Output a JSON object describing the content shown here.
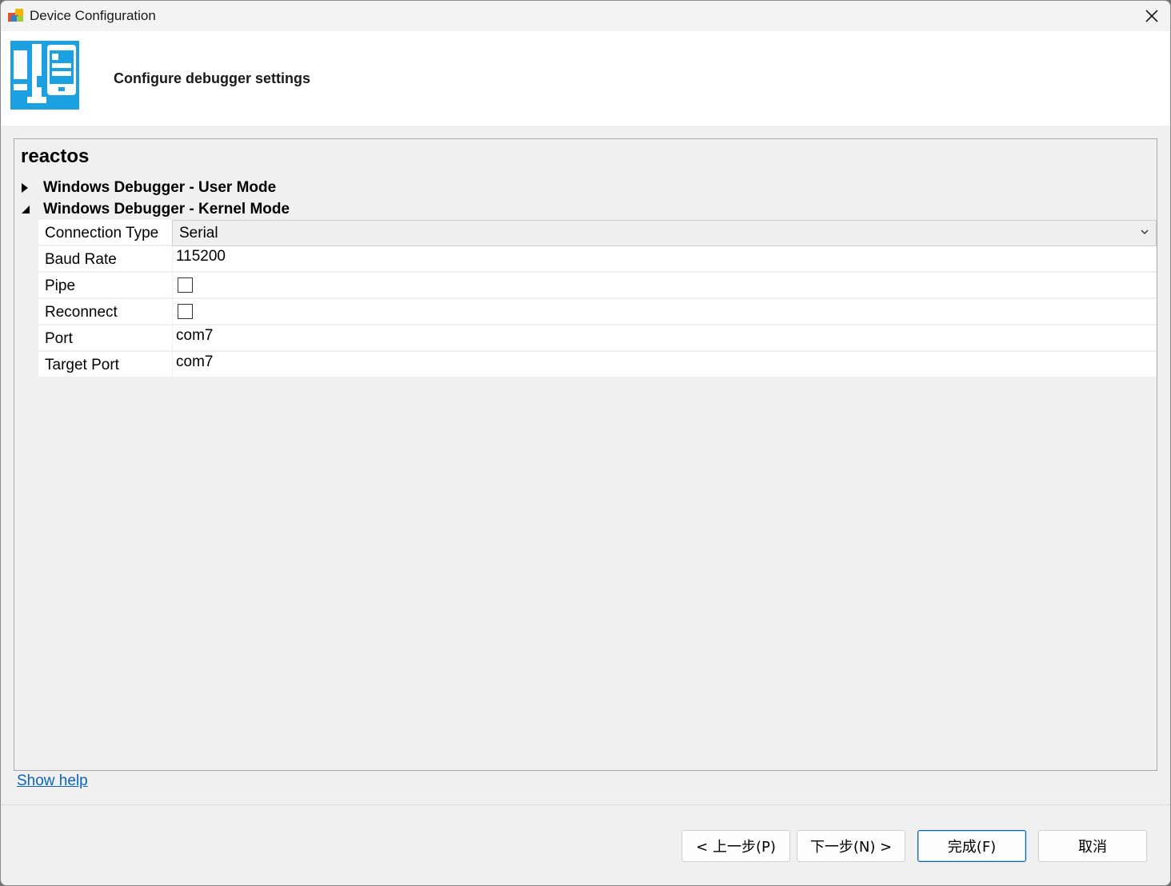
{
  "window": {
    "title": "Device Configuration"
  },
  "header": {
    "title": "Configure debugger settings"
  },
  "panel": {
    "device_name": "reactos",
    "groups": [
      {
        "label": "Windows Debugger - User Mode",
        "expanded": false
      },
      {
        "label": "Windows Debugger - Kernel Mode",
        "expanded": true
      }
    ],
    "properties": [
      {
        "name": "Connection Type",
        "value": "Serial",
        "kind": "dropdown"
      },
      {
        "name": "Baud Rate",
        "value": "115200",
        "kind": "text"
      },
      {
        "name": "Pipe",
        "checked": false,
        "kind": "checkbox"
      },
      {
        "name": "Reconnect",
        "checked": false,
        "kind": "checkbox"
      },
      {
        "name": "Port",
        "value": "com7",
        "kind": "text"
      },
      {
        "name": "Target Port",
        "value": "com7",
        "kind": "text"
      }
    ]
  },
  "footer": {
    "show_help": "Show help",
    "back_label": "< 上一步(P)",
    "next_label": "下一步(N) >",
    "finish_label": "完成(F)",
    "cancel_label": "取消"
  },
  "colors": {
    "accent": "#1ba1e2",
    "link": "#0a63c9",
    "primary_button_border": "#005fb8"
  },
  "icons": {
    "close": "close-icon",
    "expand_collapsed": "triangle-right-icon",
    "expand_open": "triangle-down-icon",
    "dropdown": "chevron-down-icon"
  }
}
